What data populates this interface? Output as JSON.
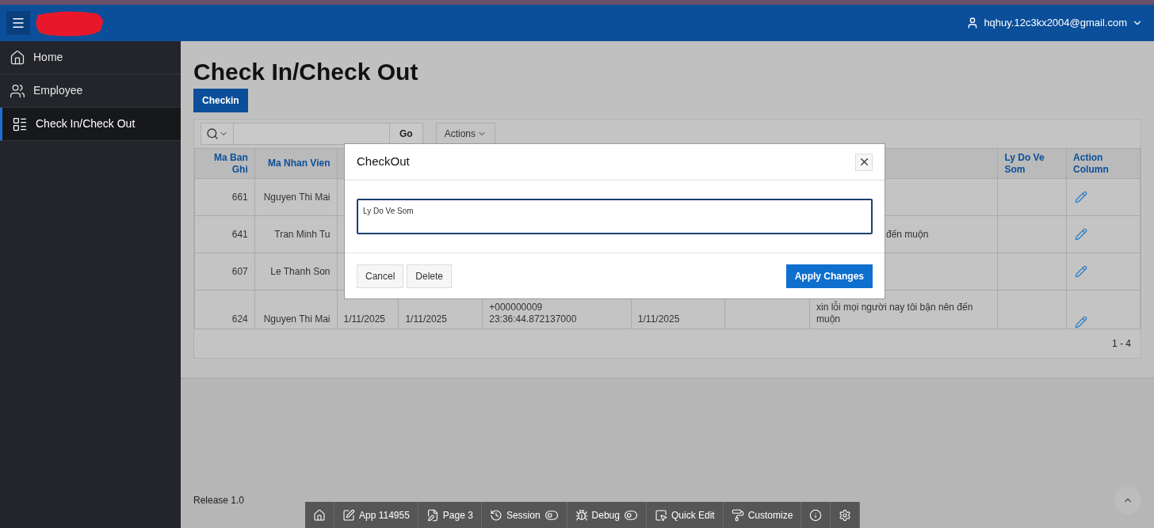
{
  "header": {
    "user": "hqhuy.12c3kx2004@gmail.com"
  },
  "sidebar": {
    "items": [
      {
        "label": "Home",
        "selected": false
      },
      {
        "label": "Employee",
        "selected": false
      },
      {
        "label": "Check In/Check Out",
        "selected": true
      }
    ]
  },
  "page": {
    "title": "Check In/Check Out",
    "primary_button": "Checkin"
  },
  "report": {
    "go_button": "Go",
    "actions_button": "Actions",
    "columns": [
      "Ma Ban Ghi",
      "Ma Nhan Vien",
      "",
      "",
      "",
      "",
      "",
      "",
      "Ly Do Ve Som",
      "Action Column"
    ],
    "rows": [
      {
        "cells": [
          {
            "text": "661"
          },
          {
            "text": "Nguyen Thi Mai"
          },
          {
            "text": ""
          },
          {
            "text": ""
          },
          {
            "text": ""
          },
          {
            "text": ""
          },
          {
            "text": ""
          },
          {
            "text": ""
          },
          {
            "text": ""
          }
        ]
      },
      {
        "cells": [
          {
            "text": "641"
          },
          {
            "text": "Tran Minh Tu"
          },
          {
            "text": ""
          },
          {
            "text": ""
          },
          {
            "text": ""
          },
          {
            "text": ""
          },
          {
            "text": ""
          },
          {
            "text": "đến muộn",
            "partial": true
          },
          {
            "text": ""
          }
        ]
      },
      {
        "cells": [
          {
            "text": "607"
          },
          {
            "text": "Le Thanh Son"
          },
          {
            "text": ""
          },
          {
            "text": ""
          },
          {
            "text": ""
          },
          {
            "text": ""
          },
          {
            "text": ""
          },
          {
            "text": ""
          },
          {
            "text": ""
          }
        ]
      },
      {
        "cells": [
          {
            "text": "624"
          },
          {
            "text": "Nguyen Thi Mai"
          },
          {
            "text": "1/11/2025"
          },
          {
            "text": "1/11/2025"
          },
          {
            "text": "+000000009 23:36:44.872137000"
          },
          {
            "text": "1/11/2025"
          },
          {
            "text": ""
          },
          {
            "text": "xin lỗi mọi người nay tôi bận nên đến muộn"
          },
          {
            "text": ""
          }
        ]
      }
    ],
    "pagination": "1 - 4"
  },
  "dialog": {
    "title": "CheckOut",
    "field_label": "Ly Do Ve Som",
    "buttons": [
      "Cancel",
      "Delete"
    ],
    "apply_button": "Apply Changes"
  },
  "footer": {
    "release": "Release 1.0"
  },
  "dev_toolbar": [
    {
      "toggle": false
    },
    {
      "label": "App 114955",
      "toggle": false
    },
    {
      "label": "Page 3",
      "toggle": false
    },
    {
      "label": "Session",
      "toggle": true
    },
    {
      "label": "Debug",
      "toggle": true
    },
    {
      "label": "Quick Edit",
      "toggle": false
    },
    {
      "label": "Customize",
      "toggle": false
    },
    {
      "toggle": false
    },
    {
      "toggle": false
    }
  ]
}
